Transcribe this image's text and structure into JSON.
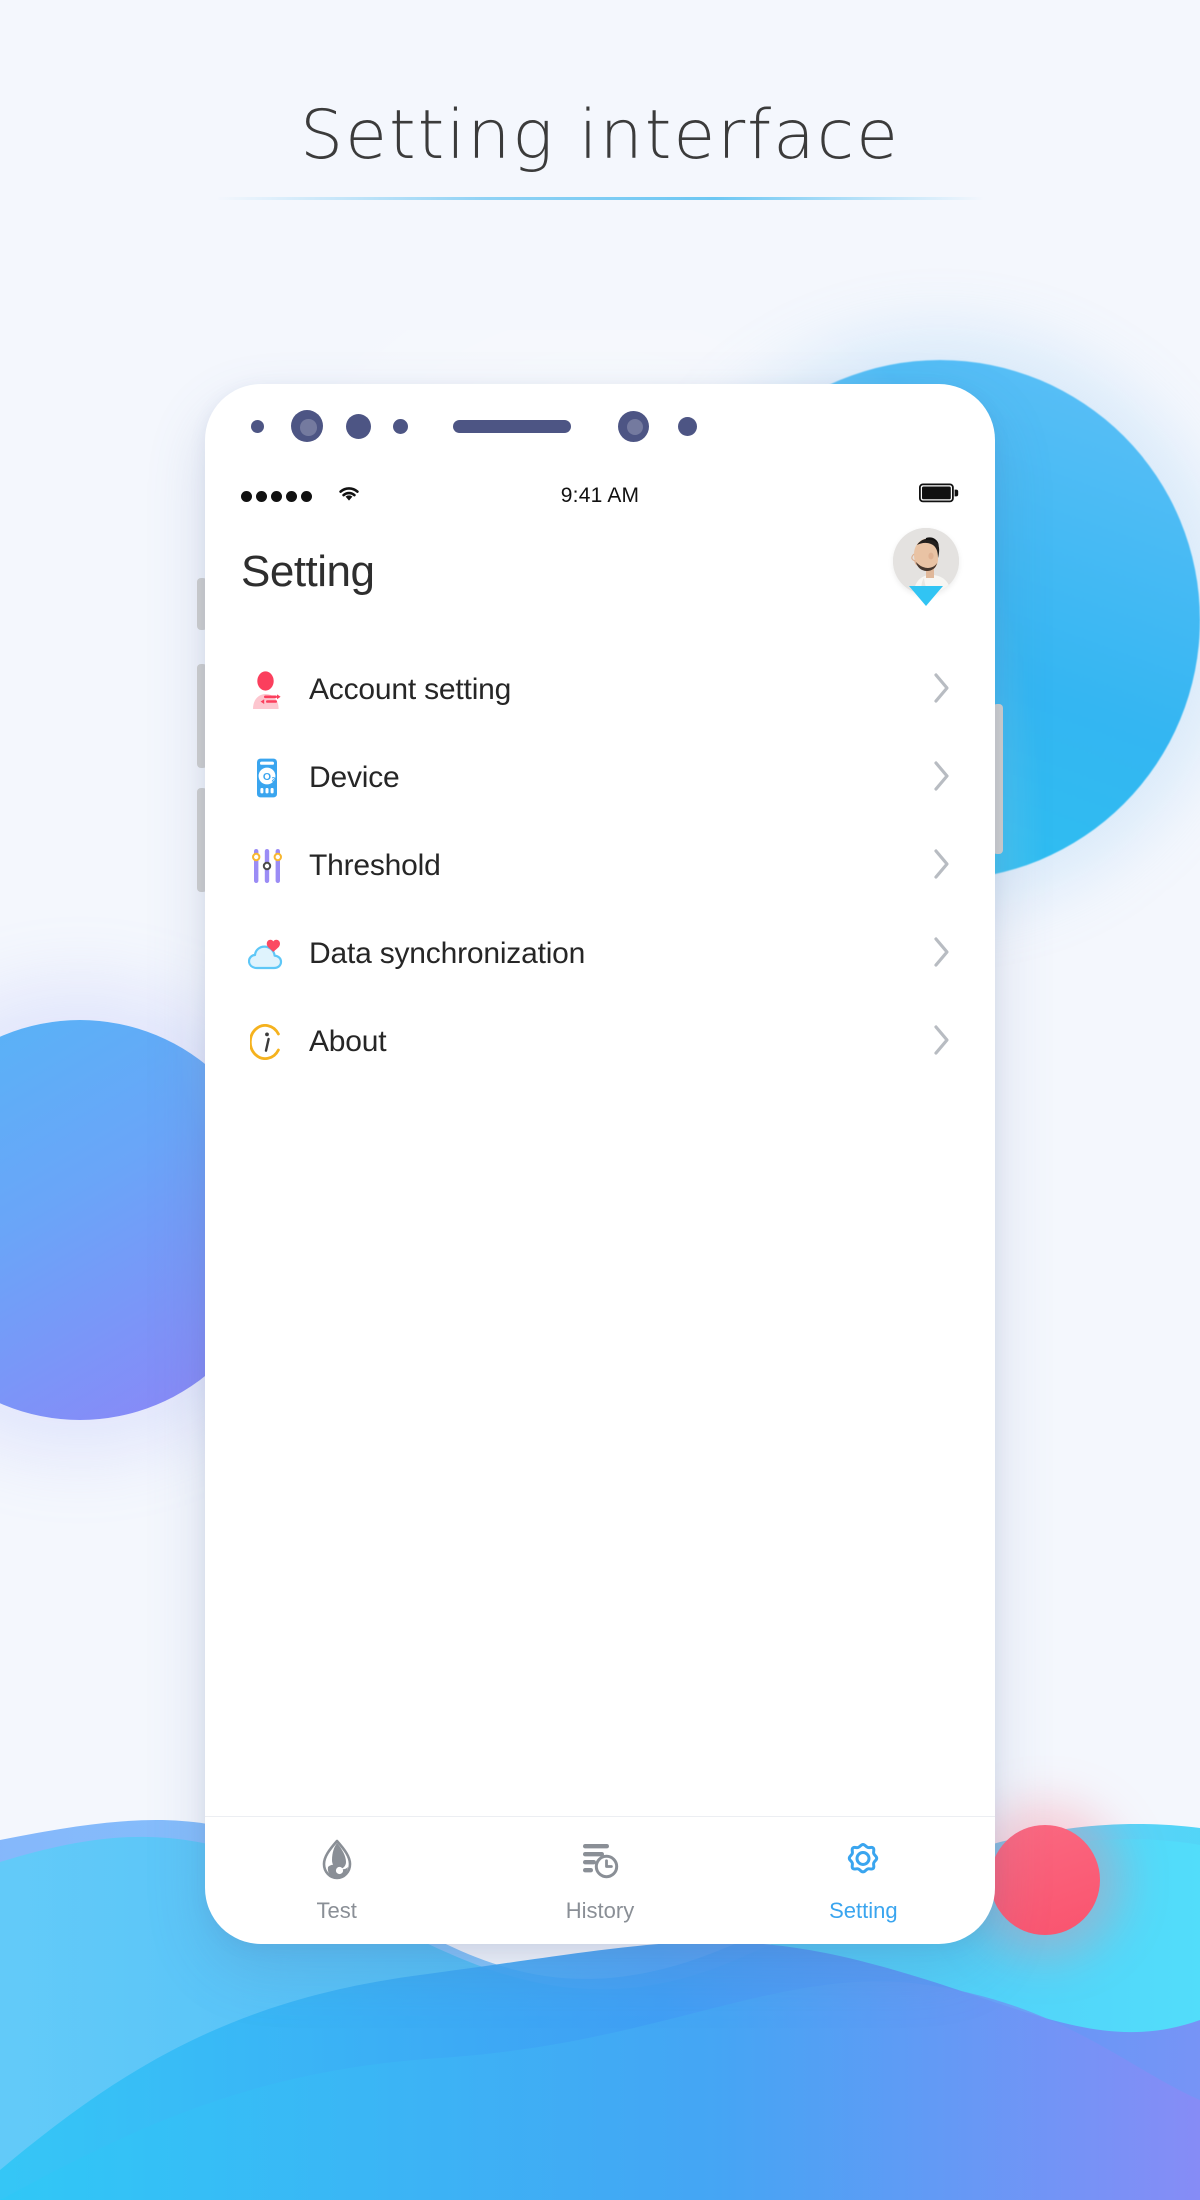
{
  "page": {
    "heading": "Setting interface",
    "background_color": "#f4f7fd"
  },
  "phone": {
    "status_bar": {
      "signal_dots": 5,
      "wifi_icon": "wifi-icon",
      "time": "9:41 AM",
      "battery_icon": "battery-full-icon"
    },
    "header": {
      "title": "Setting",
      "avatar": "user-avatar",
      "avatar_caret": "caret-down-icon"
    },
    "menu": {
      "items": [
        {
          "label": "Account setting",
          "icon": "account-person-icon",
          "icon_color": "#fb4a62",
          "chevron": "chevron-right-icon"
        },
        {
          "label": "Device",
          "icon": "oximeter-device-icon",
          "icon_color": "#3aa5ef",
          "chevron": "chevron-right-icon"
        },
        {
          "label": "Threshold",
          "icon": "sliders-icon",
          "icon_color": "#9b8cf5",
          "chevron": "chevron-right-icon"
        },
        {
          "label": "Data synchronization",
          "icon": "cloud-heart-icon",
          "icon_color": "#5ec7f7",
          "chevron": "chevron-right-icon"
        },
        {
          "label": "About",
          "icon": "info-circle-icon",
          "icon_color": "#f5b21e",
          "chevron": "chevron-right-icon"
        }
      ]
    },
    "tab_bar": {
      "active_color": "#3aa5ef",
      "inactive_color": "#8a8f96",
      "tabs": [
        {
          "label": "Test",
          "icon": "blood-drop-icon",
          "active": false
        },
        {
          "label": "History",
          "icon": "list-clock-icon",
          "active": false
        },
        {
          "label": "Setting",
          "icon": "gear-icon",
          "active": true
        }
      ]
    }
  },
  "decorations": {
    "cyan_circle": "#34b6f2",
    "purple_circle": "#8f83f7",
    "pink_circle": "#f9536e",
    "wave_colors": [
      "#8fbcfb",
      "#5fd5f7",
      "#3cb9f5",
      "#7b8cf6"
    ]
  }
}
